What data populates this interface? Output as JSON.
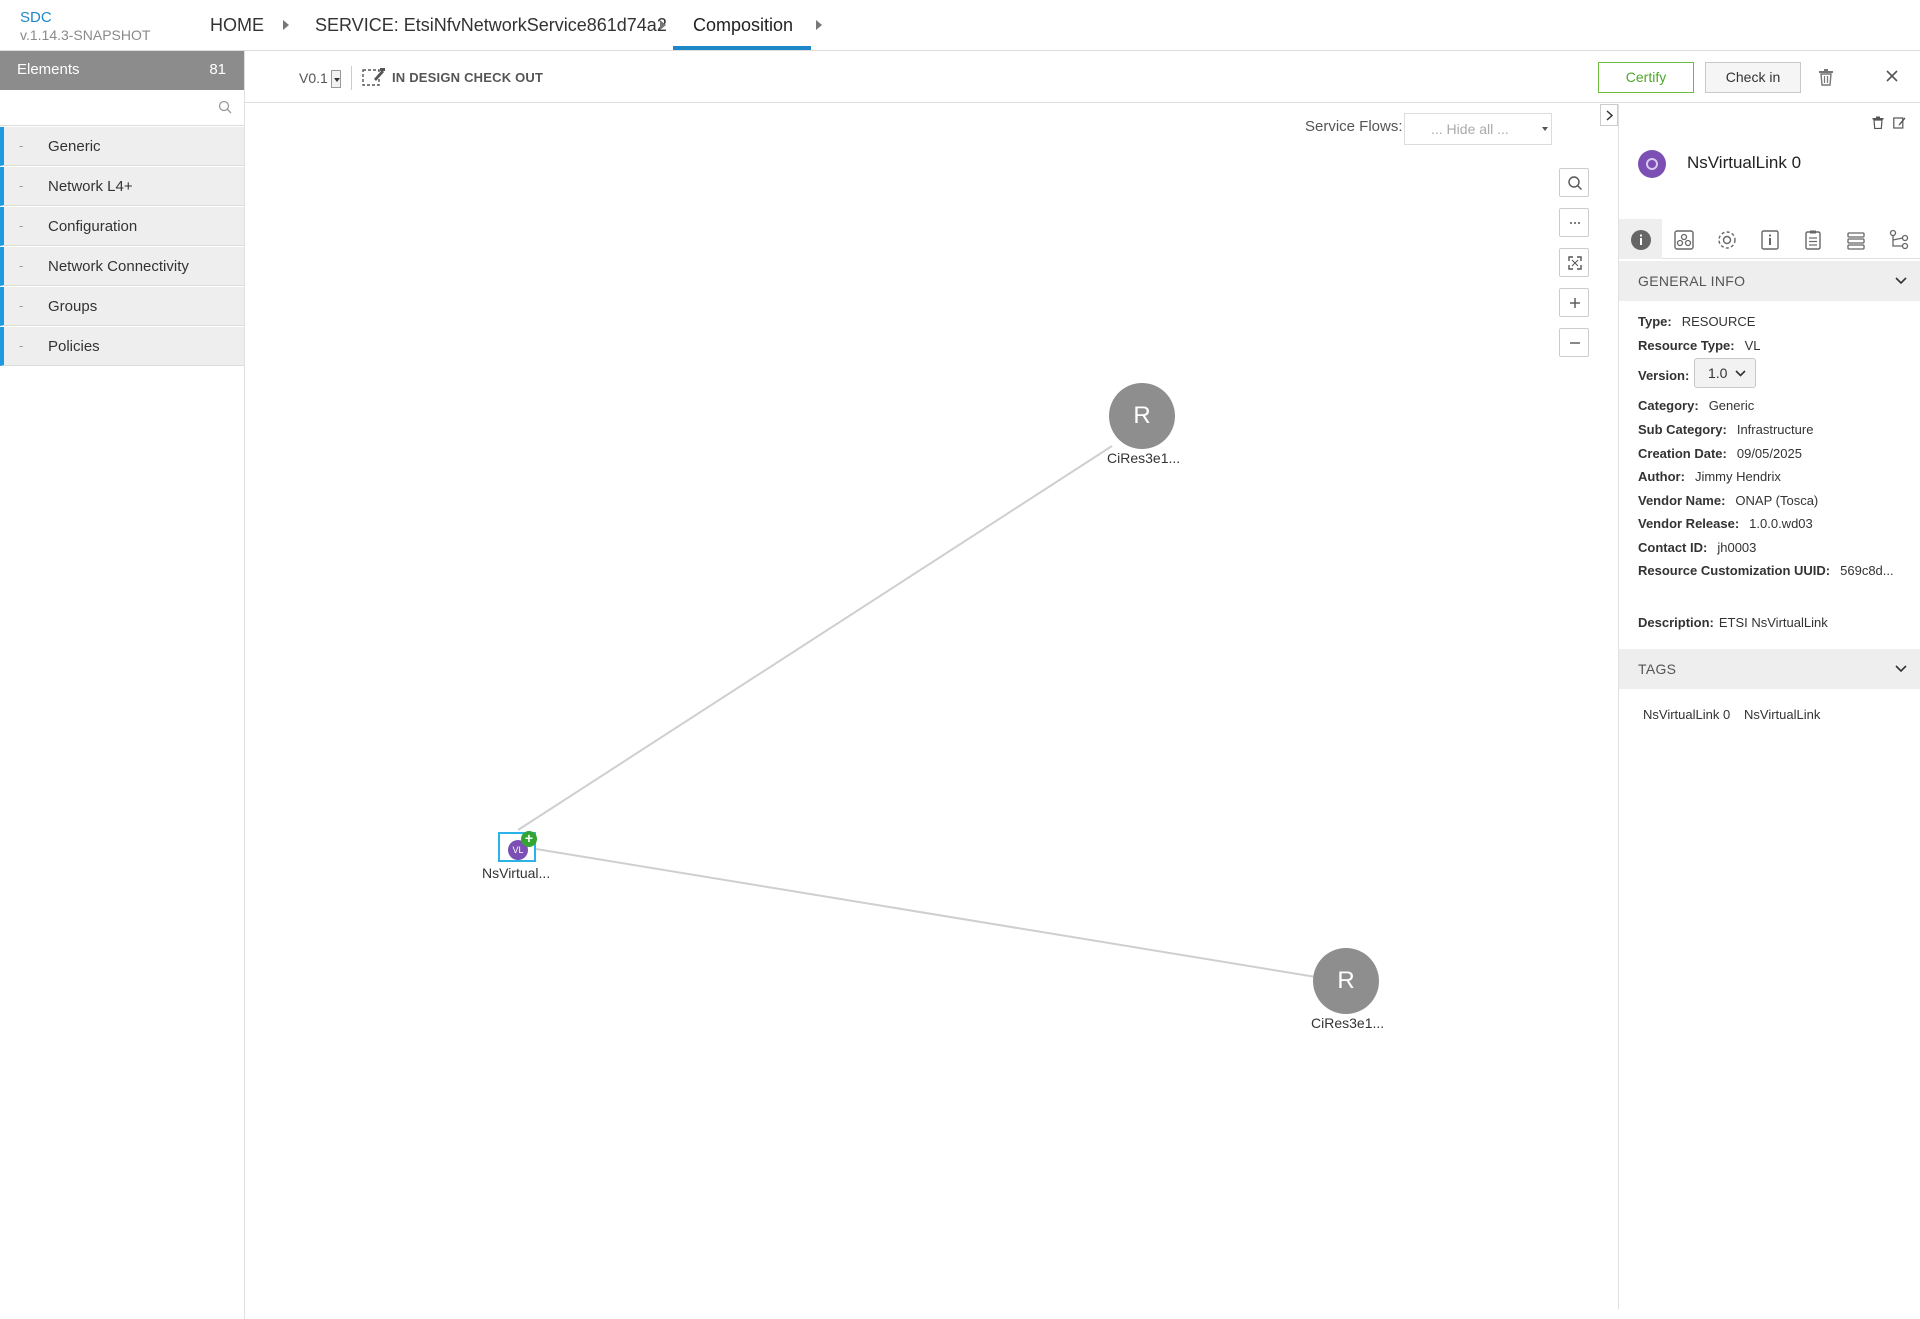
{
  "app": {
    "name": "SDC",
    "version": "v.1.14.3-SNAPSHOT"
  },
  "breadcrumb": {
    "home": "HOME",
    "service": "SERVICE: EtsiNfvNetworkService861d74a2",
    "current": "Composition"
  },
  "palette": {
    "title": "Elements",
    "count": "81",
    "search_placeholder": "",
    "categories": [
      {
        "label": "Generic"
      },
      {
        "label": "Network L4+"
      },
      {
        "label": "Configuration"
      },
      {
        "label": "Network Connectivity"
      },
      {
        "label": "Groups"
      },
      {
        "label": "Policies"
      }
    ]
  },
  "toolbar": {
    "version": "V0.1",
    "lifecycle_state": "IN DESIGN CHECK OUT",
    "certify_label": "Certify",
    "checkin_label": "Check in"
  },
  "canvas": {
    "service_flows_label": "Service Flows:",
    "service_flows_value": "... Hide all ...",
    "nodes": [
      {
        "label": "CiRes3e1...",
        "letter": "R"
      },
      {
        "label": "CiRes3e1...",
        "letter": "R"
      },
      {
        "label": "NsVirtual...",
        "badge": "VL"
      }
    ]
  },
  "details": {
    "title": "NsVirtualLink 0",
    "general_info_title": "GENERAL INFO",
    "props": {
      "type": {
        "label": "Type:",
        "value": "RESOURCE"
      },
      "resource_type": {
        "label": "Resource Type:",
        "value": "VL"
      },
      "version": {
        "label": "Version:",
        "value": "1.0"
      },
      "category": {
        "label": "Category:",
        "value": "Generic"
      },
      "sub_category": {
        "label": "Sub Category:",
        "value": "Infrastructure"
      },
      "creation_date": {
        "label": "Creation Date:",
        "value": "09/05/2025"
      },
      "author": {
        "label": "Author:",
        "value": "Jimmy Hendrix"
      },
      "vendor_name": {
        "label": "Vendor Name:",
        "value": "ONAP (Tosca)"
      },
      "vendor_release": {
        "label": "Vendor Release:",
        "value": "1.0.0.wd03"
      },
      "contact_id": {
        "label": "Contact ID:",
        "value": "jh0003"
      },
      "customization_uuid": {
        "label": "Resource Customization UUID:",
        "value": "569c8d..."
      },
      "description": {
        "label": "Description:",
        "value": "ETSI NsVirtualLink"
      }
    },
    "tags_title": "TAGS",
    "tags": [
      "NsVirtualLink 0",
      "NsVirtualLink"
    ]
  },
  "colors": {
    "accent": "#1e87c8",
    "palette_accent": "#1e9be0",
    "certify": "#4ea72a",
    "node": "#8e8e8e",
    "vl_node": "#7b4fb3"
  }
}
